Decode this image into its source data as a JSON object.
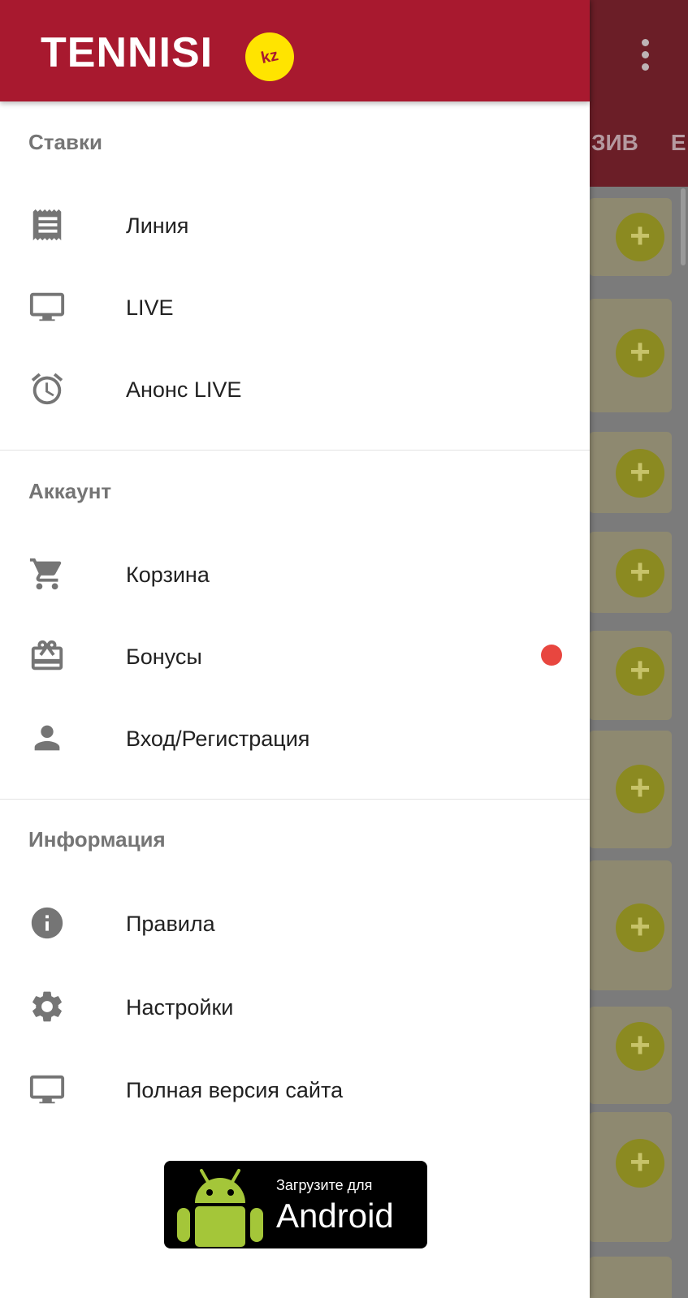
{
  "background": {
    "tabs": [
      "ЗИВ",
      "Е"
    ]
  },
  "brand": {
    "name": "TENNISI",
    "badge": "kz",
    "color": "#a8192f",
    "badge_color": "#ffe400"
  },
  "sections": [
    {
      "title": "Ставки",
      "items": [
        {
          "label": "Линия",
          "icon": "receipt-icon"
        },
        {
          "label": "LIVE",
          "icon": "monitor-icon"
        },
        {
          "label": "Анонс LIVE",
          "icon": "alarm-clock-icon"
        }
      ]
    },
    {
      "title": "Аккаунт",
      "items": [
        {
          "label": "Корзина",
          "icon": "cart-icon"
        },
        {
          "label": "Бонусы",
          "icon": "gift-card-icon",
          "badge_color": "#e8463f"
        },
        {
          "label": "Вход/Регистрация",
          "icon": "person-icon"
        }
      ]
    },
    {
      "title": "Информация",
      "items": [
        {
          "label": "Правила",
          "icon": "info-icon"
        },
        {
          "label": "Настройки",
          "icon": "gear-icon"
        },
        {
          "label": "Полная версия сайта",
          "icon": "monitor-icon"
        }
      ]
    }
  ],
  "android_badge": {
    "small_text": "Загрузите для",
    "big_text": "Android",
    "icon": "android-robot-icon"
  }
}
